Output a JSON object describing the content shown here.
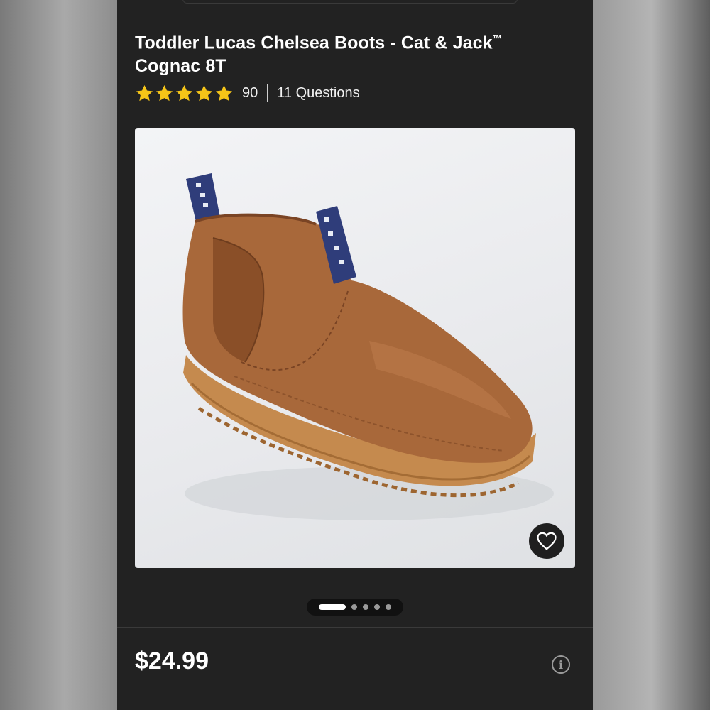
{
  "product": {
    "title": "Toddler Lucas Chelsea Boots - Cat & Jack",
    "trademark": "™",
    "variant": "Cognac 8T",
    "rating_stars": 5,
    "rating_count": "90",
    "questions": "11 Questions",
    "price": "$24.99"
  },
  "image": {
    "description_icon": "boot-image",
    "carousel_count": 5,
    "carousel_active_index": 0
  },
  "icons": {
    "favorite": "heart-icon",
    "info": "info-icon",
    "info_glyph": "i"
  },
  "colors": {
    "background": "#222222",
    "star": "#f5c518",
    "boot": "#a8683a",
    "sole": "#c58a4e",
    "tab": "#2f3d7a"
  }
}
